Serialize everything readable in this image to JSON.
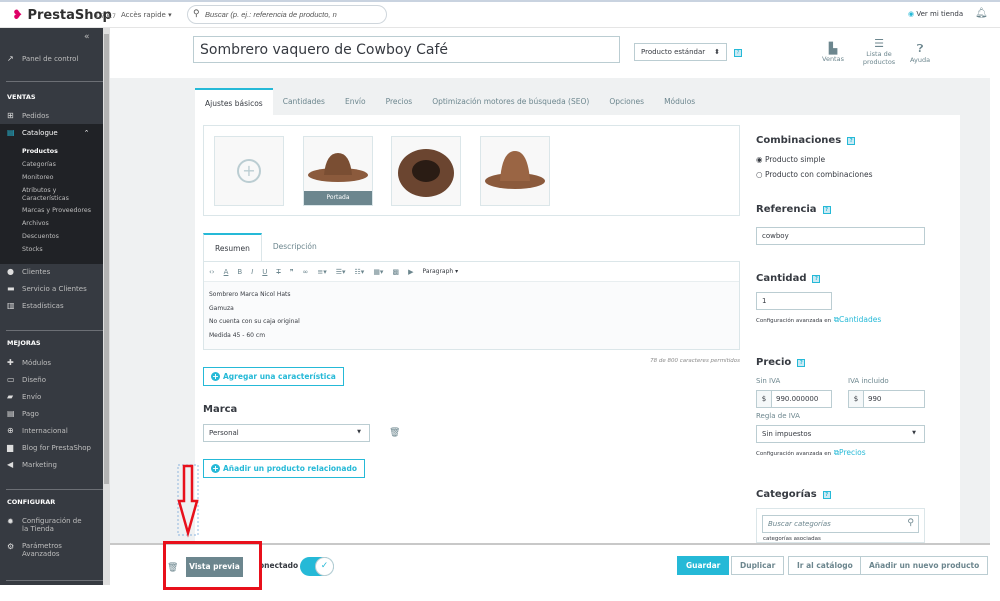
{
  "topbar": {
    "logo": "PrestaShop",
    "version": "1.7.6.7",
    "quick_access": "Accès rapide ▾",
    "search_placeholder": "Buscar (p. ej.: referencia de producto, n",
    "view_store": "Ver mi tienda"
  },
  "sidebar": {
    "collapse": "«",
    "dashboard": "Panel de control",
    "sections": [
      "VENTAS",
      "MEJORAS",
      "CONFIGURAR"
    ],
    "ventas": [
      "Pedidos",
      "Catalogue"
    ],
    "catalogue_sub": [
      "Productos",
      "Categorías",
      "Monitoreo",
      "Atributos y Características",
      "Marcas y Proveedores",
      "Archivos",
      "Descuentos",
      "Stocks"
    ],
    "ventas2": [
      "Clientes",
      "Servicio a Clientes",
      "Estadísticas"
    ],
    "mejoras": [
      "Módulos",
      "Diseño",
      "Envío",
      "Pago",
      "Internacional",
      "Blog for PrestaShop",
      "Marketing"
    ],
    "configurar": [
      "Configuración de la Tienda",
      "Parámetros Avanzados"
    ]
  },
  "header": {
    "product_name": "Sombrero vaquero de Cowboy Café",
    "product_type": "Producto estándar",
    "help": "?",
    "actions": [
      "Ventas",
      "Lista de productos",
      "Ayuda"
    ]
  },
  "tabs": [
    "Ajustes básicos",
    "Cantidades",
    "Envío",
    "Precios",
    "Optimización motores de búsqueda (SEO)",
    "Opciones",
    "Módulos"
  ],
  "images": {
    "cover_label": "Portada"
  },
  "editor": {
    "tabs": [
      "Resumen",
      "Descripción"
    ],
    "format": "Paragraph ▾",
    "lines": [
      "Sombrero Marca Nicol Hats",
      "Gamuza",
      "No cuenta con su caja original",
      "Medida 45 - 60 cm"
    ],
    "counter": "78 de 800 caracteres permitidos"
  },
  "add_feature": "Agregar una característica",
  "brand": {
    "title": "Marca",
    "value": "Personal"
  },
  "add_related": "Añadir un producto relacionado",
  "right": {
    "combinations": {
      "title": "Combinaciones",
      "options": [
        "Producto simple",
        "Producto con combinaciones"
      ],
      "selected": 0
    },
    "reference": {
      "title": "Referencia",
      "value": "cowboy"
    },
    "quantity": {
      "title": "Cantidad",
      "value": "1",
      "advanced": "Configuración avanzada en",
      "link": "Cantidades"
    },
    "price": {
      "title": "Precio",
      "tax_excl_label": "Sin IVA",
      "tax_incl_label": "IVA incluido",
      "currency": "$",
      "tax_excl": "990.000000",
      "tax_incl": "990",
      "tax_rule_label": "Regla de IVA",
      "tax_rule": "Sin impuestos",
      "advanced": "Configuración avanzada en",
      "link": "Precios"
    },
    "categories": {
      "title": "Categorías",
      "search_placeholder": "Buscar categorías",
      "assoc": "categorías asociadas"
    }
  },
  "footer": {
    "preview": "Vista previa",
    "online": "onectado",
    "online_state": true,
    "save": "Guardar",
    "duplicate": "Duplicar",
    "catalog": "Ir al catálogo",
    "new_product": "Añadir un nuevo producto"
  },
  "colors": {
    "accent": "#25b9d7",
    "sidebar": "#363a41",
    "highlight": "#e8101b"
  }
}
